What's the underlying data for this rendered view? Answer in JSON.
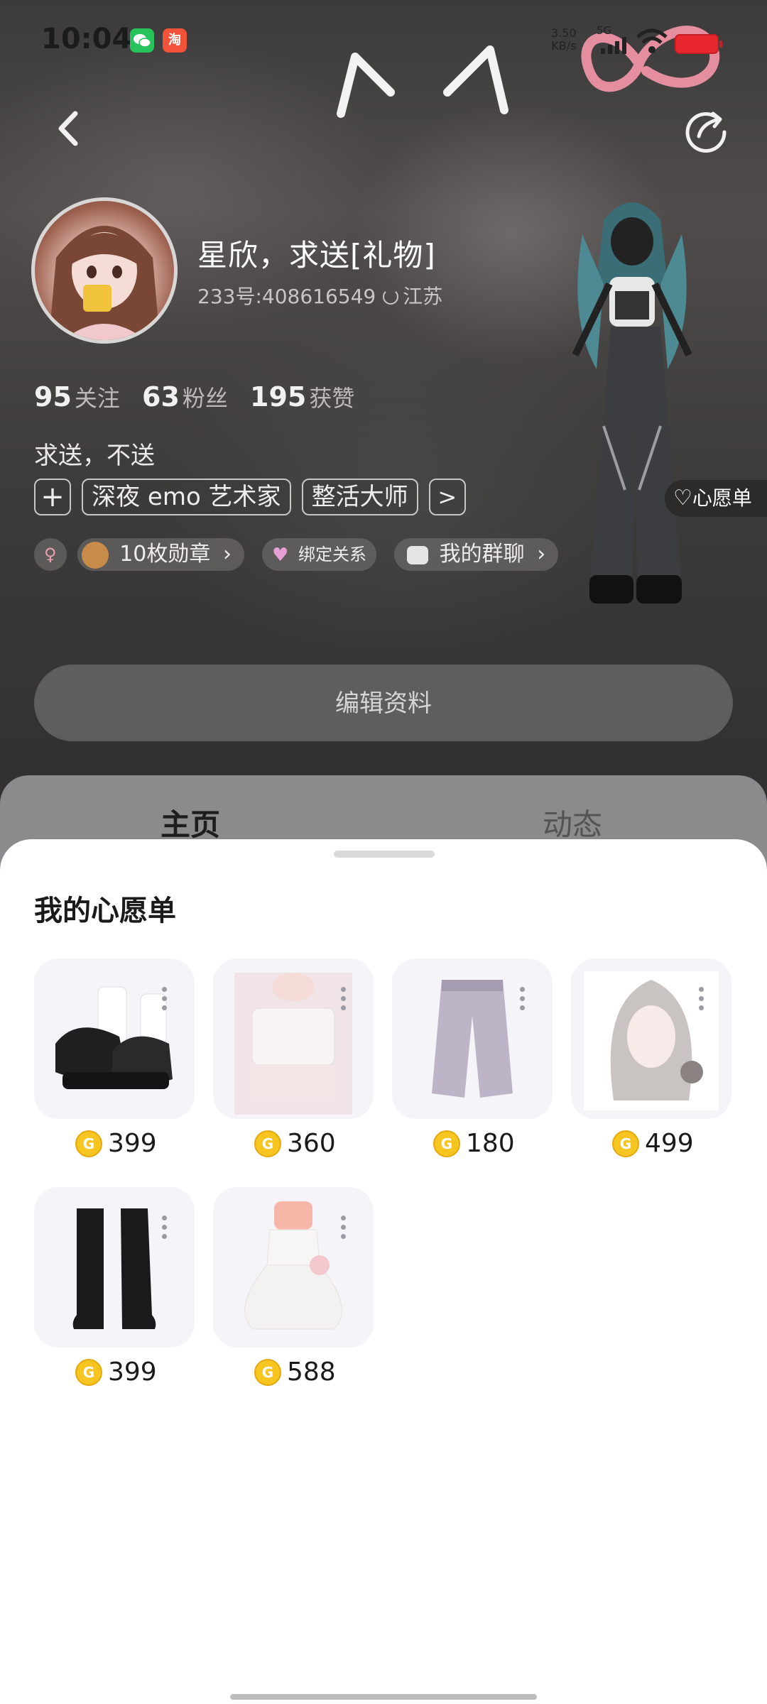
{
  "status_bar": {
    "time": "10:04",
    "net_speed_value": "3.50",
    "net_speed_unit": "KB/s",
    "signal_label": "5G",
    "taobao_badge": "淘"
  },
  "profile": {
    "nickname": "星欣，求送[礼物]",
    "uid": "233号:408616549",
    "location": "江苏",
    "stats": [
      {
        "num": "95",
        "label": "关注"
      },
      {
        "num": "63",
        "label": "粉丝"
      },
      {
        "num": "195",
        "label": "获赞"
      }
    ],
    "bio": "求送，不送",
    "add_tag": "+",
    "tags": [
      "深夜 emo 艺术家",
      "整活大师"
    ],
    "more_tags": ">",
    "gender_icon": "♀",
    "badges_label": "10枚勋章",
    "bind_label": "绑定关系",
    "group_chat_label": "我的群聊",
    "chevron": "›",
    "wishlist_tag": "心愿单",
    "edit_button": "编辑资料"
  },
  "tabs": [
    {
      "label": "主页",
      "active": true
    },
    {
      "label": "动态",
      "active": false
    }
  ],
  "wishlist": {
    "title": "我的心愿单",
    "items": [
      {
        "name": "black-platform-shoes",
        "price": "399"
      },
      {
        "name": "white-lace-top",
        "price": "360"
      },
      {
        "name": "lavender-pants",
        "price": "180"
      },
      {
        "name": "silver-hair",
        "price": "499"
      },
      {
        "name": "black-boots",
        "price": "399"
      },
      {
        "name": "white-dress",
        "price": "588"
      }
    ]
  },
  "colors": {
    "coin": "#f7c520",
    "sheet_bg": "#ffffff",
    "thumb_bg": "#f5f4f8"
  }
}
